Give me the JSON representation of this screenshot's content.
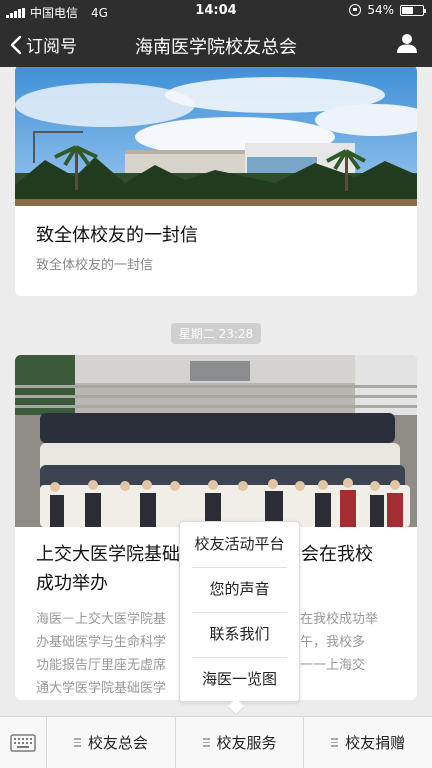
{
  "status_bar": {
    "carrier": "中国电信",
    "network": "4G",
    "time": "14:04",
    "battery": "54%",
    "battery_level": 0.54
  },
  "nav": {
    "back_label": "订阅号",
    "title": "海南医学院校友总会",
    "icon_back": "chevron-left-icon",
    "icon_user": "user-icon"
  },
  "articles": [
    {
      "title": "致全体校友的一封信",
      "subtitle": "致全体校友的一封信"
    },
    {
      "title_line1": "上交大医学院基础",
      "title_line1_right": "会在我校",
      "title_line2": "成功举办",
      "desc_l1_left": "海医－上交大医学院基",
      "desc_l1_right": "会在我校成功举",
      "desc_l2_left": "办基础医学与生命科学",
      "desc_l2_right": "上午，我校多",
      "desc_l3_left": "功能报告厅里座无虚席",
      "desc_l3_right": "院一一上海交",
      "desc_l4_left": "通大学医学院基础医学",
      "desc_l4_right": "..."
    }
  ],
  "timestamp": "星期二 23:28",
  "popup_menu": {
    "items": [
      "校友活动平台",
      "您的声音",
      "联系我们",
      "海医一览图"
    ]
  },
  "bottom_menu": {
    "keyboard_icon": "keyboard-icon",
    "items": [
      "校友总会",
      "校友服务",
      "校友捐赠"
    ]
  },
  "colors": {
    "bar_bg": "#2e2e2e",
    "page_bg": "#ececec"
  }
}
